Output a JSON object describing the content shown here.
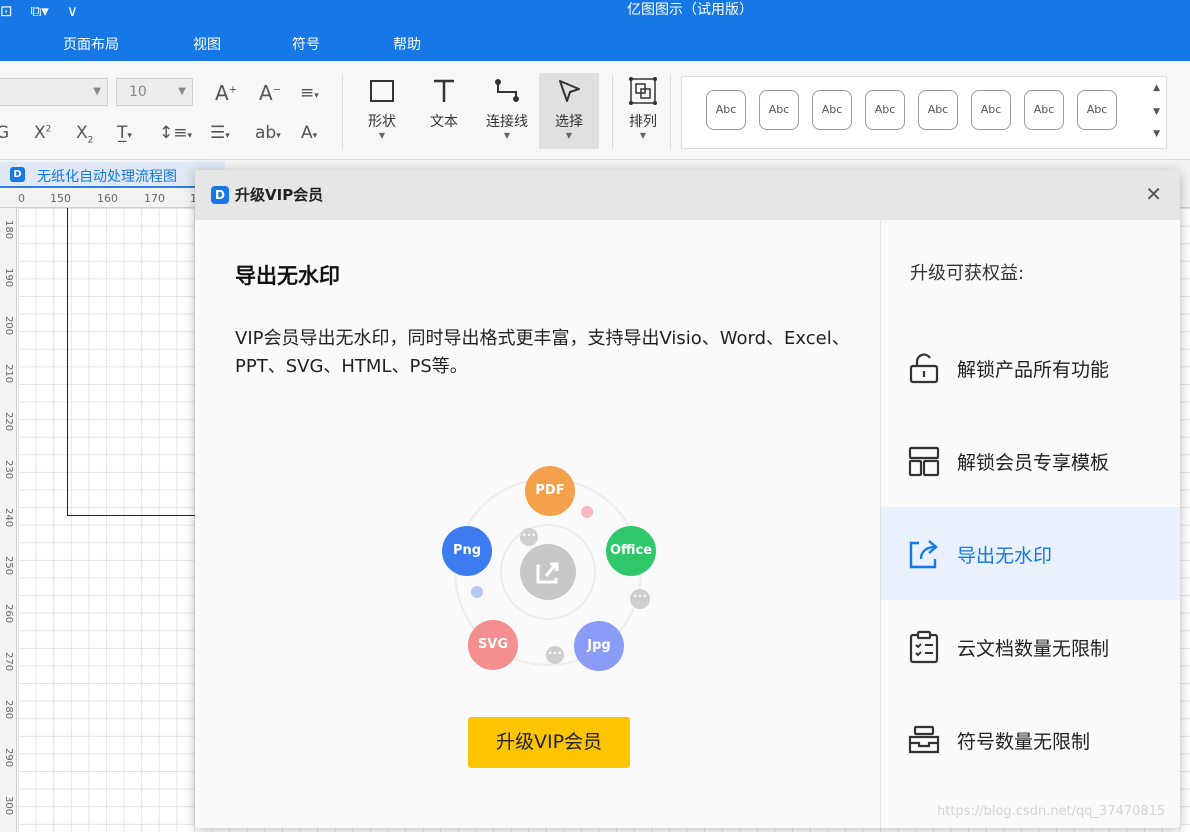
{
  "window": {
    "title": "亿图图示（试用版）",
    "quick_access": [
      "⊡",
      "⧉▾",
      "∨"
    ]
  },
  "menu": {
    "items": [
      "页面布局",
      "视图",
      "符号",
      "帮助"
    ]
  },
  "ribbon": {
    "font_size": "10",
    "tools": [
      {
        "label": "形状"
      },
      {
        "label": "文本"
      },
      {
        "label": "连接线"
      },
      {
        "label": "选择"
      },
      {
        "label": "排列"
      }
    ],
    "style_swatches": [
      "Abc",
      "Abc",
      "Abc",
      "Abc",
      "Abc",
      "Abc",
      "Abc",
      "Abc"
    ]
  },
  "document_tab": {
    "name": "无纸化自动处理流程图",
    "icon_letter": "D"
  },
  "ruler": {
    "horizontal": [
      "0",
      "150",
      "160",
      "170",
      "1"
    ],
    "vertical": [
      "180",
      "190",
      "200",
      "210",
      "220",
      "230",
      "240",
      "250",
      "260",
      "270",
      "280",
      "290",
      "300"
    ]
  },
  "dialog": {
    "title": "升级VIP会员",
    "heading": "导出无水印",
    "description": "VIP会员导出无水印，同时导出格式更丰富，支持导出Visio、Word、Excel、PPT、SVG、HTML、PS等。",
    "formats": [
      {
        "label": "PDF",
        "color": "#f5a04a"
      },
      {
        "label": "Office",
        "color": "#2ec86b"
      },
      {
        "label": "Jpg",
        "color": "#8a9cf5"
      },
      {
        "label": "SVG",
        "color": "#f58f8f"
      },
      {
        "label": "Png",
        "color": "#3d7cf0"
      }
    ],
    "cta_label": "升级VIP会员",
    "benefits_title": "升级可获权益:",
    "benefits": [
      {
        "label": "解锁产品所有功能",
        "icon": "unlock-icon"
      },
      {
        "label": "解锁会员专享模板",
        "icon": "template-icon"
      },
      {
        "label": "导出无水印",
        "icon": "export-icon",
        "active": true
      },
      {
        "label": "云文档数量无限制",
        "icon": "clipboard-list-icon"
      },
      {
        "label": "符号数量无限制",
        "icon": "stack-icon"
      }
    ]
  },
  "watermark": "https://blog.csdn.net/qq_37470815"
}
